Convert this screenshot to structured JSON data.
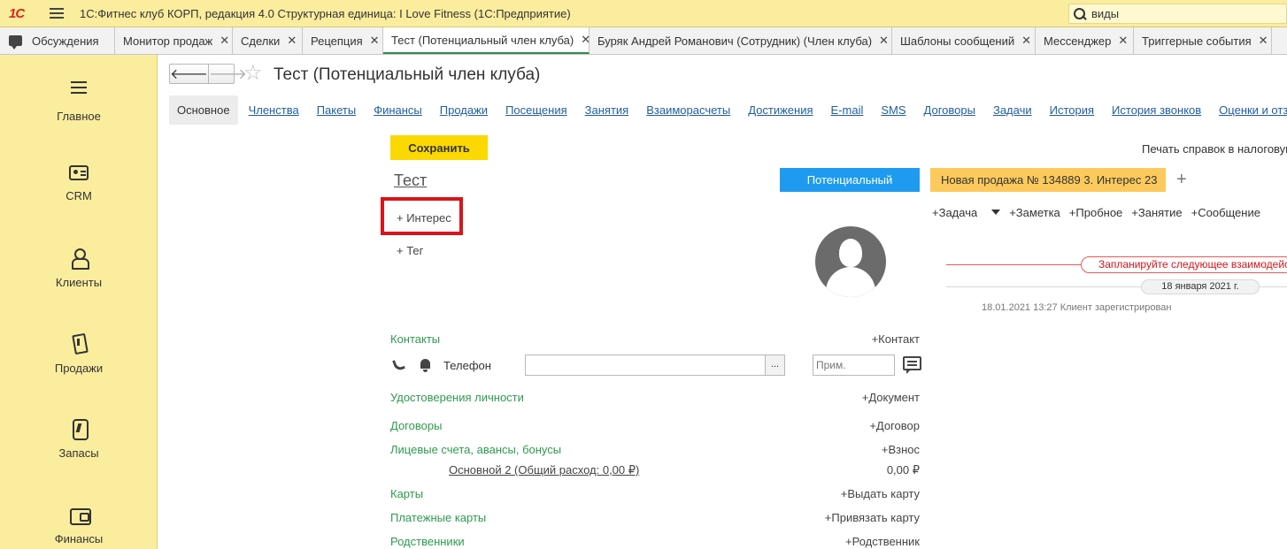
{
  "app": {
    "logo": "1С",
    "title": "1С:Фитнес клуб КОРП, редакция 4.0 Структурная единица: I Love Fitness  (1С:Предприятие)",
    "search_value": "виды"
  },
  "tabs": [
    {
      "label": "Обсуждения",
      "closable": false
    },
    {
      "label": "Монитор продаж",
      "closable": true
    },
    {
      "label": "Сделки",
      "closable": true
    },
    {
      "label": "Рецепция",
      "closable": true
    },
    {
      "label": "Тест (Потенциальный член клуба)",
      "closable": true,
      "active": true
    },
    {
      "label": "Буряк Андрей Романович (Сотрудник) (Член клуба)",
      "closable": true
    },
    {
      "label": "Шаблоны сообщений",
      "closable": true
    },
    {
      "label": "Мессенджер",
      "closable": true
    },
    {
      "label": "Триггерные события",
      "closable": true
    }
  ],
  "sidebar": {
    "items": [
      {
        "label": "Главное",
        "icon": "menu-icon"
      },
      {
        "label": "CRM",
        "icon": "crm-card-icon"
      },
      {
        "label": "Клиенты",
        "icon": "client-icon"
      },
      {
        "label": "Продажи",
        "icon": "sales-icon"
      },
      {
        "label": "Запасы",
        "icon": "stock-icon"
      },
      {
        "label": "Финансы",
        "icon": "wallet-icon"
      }
    ]
  },
  "form": {
    "title": "Тест (Потенциальный член клуба)",
    "section_tabs": [
      "Основное",
      "Членства",
      "Пакеты",
      "Финансы",
      "Продажи",
      "Посещения",
      "Занятия",
      "Взаиморасчеты",
      "Достижения",
      "E-mail",
      "SMS",
      "Договоры",
      "Задачи",
      "История",
      "История звонков",
      "Оценки и отзывы"
    ],
    "save_label": "Сохранить",
    "print_label": "Печать справок в налоговую",
    "client_name": "Тест",
    "interest_label": "+ Интерес",
    "tag_label": "+ Тег",
    "status_label": "Потенциальный",
    "sale_badge": "Новая продажа № 134889  3. Интерес 23",
    "add_label": "+",
    "actions": {
      "task": "+Задача",
      "note": "+Заметка",
      "trial": "+Пробное",
      "lesson": "+Занятие",
      "message": "+Сообщение"
    },
    "timeline": {
      "plan_label": "Запланируйте следующее взаимодействие",
      "date_label": "18 января 2021 г.",
      "event": "18.01.2021 13:27 Клиент зарегистрирован"
    },
    "contacts": {
      "label": "Контакты",
      "action": "+Контакт",
      "phone_label": "Телефон",
      "phone_value": "",
      "phone_btn": "...",
      "note_placeholder": "Прим."
    },
    "sections": [
      {
        "label": "Удостоверения личности",
        "action": "+Документ"
      },
      {
        "label": "Договоры",
        "action": "+Договор"
      },
      {
        "label": "Лицевые счета, авансы, бонусы",
        "action": "+Взнос"
      },
      {
        "label": "Карты",
        "action": "+Выдать карту"
      },
      {
        "label": "Платежные карты",
        "action": "+Привязать карту"
      },
      {
        "label": "Родственники",
        "action": "+Родственник"
      }
    ],
    "account": {
      "link": "Основной 2 (Общий расход: 0,00 ₽)",
      "value": "0,00 ₽"
    }
  },
  "colors": {
    "sidebar_bg": "#fbed9e",
    "save_button": "#fbd800",
    "status_blue": "#1e9bf0",
    "sale_badge": "#fcca5c",
    "highlight_red": "#d9141b",
    "section_green": "#2e9a4f"
  }
}
